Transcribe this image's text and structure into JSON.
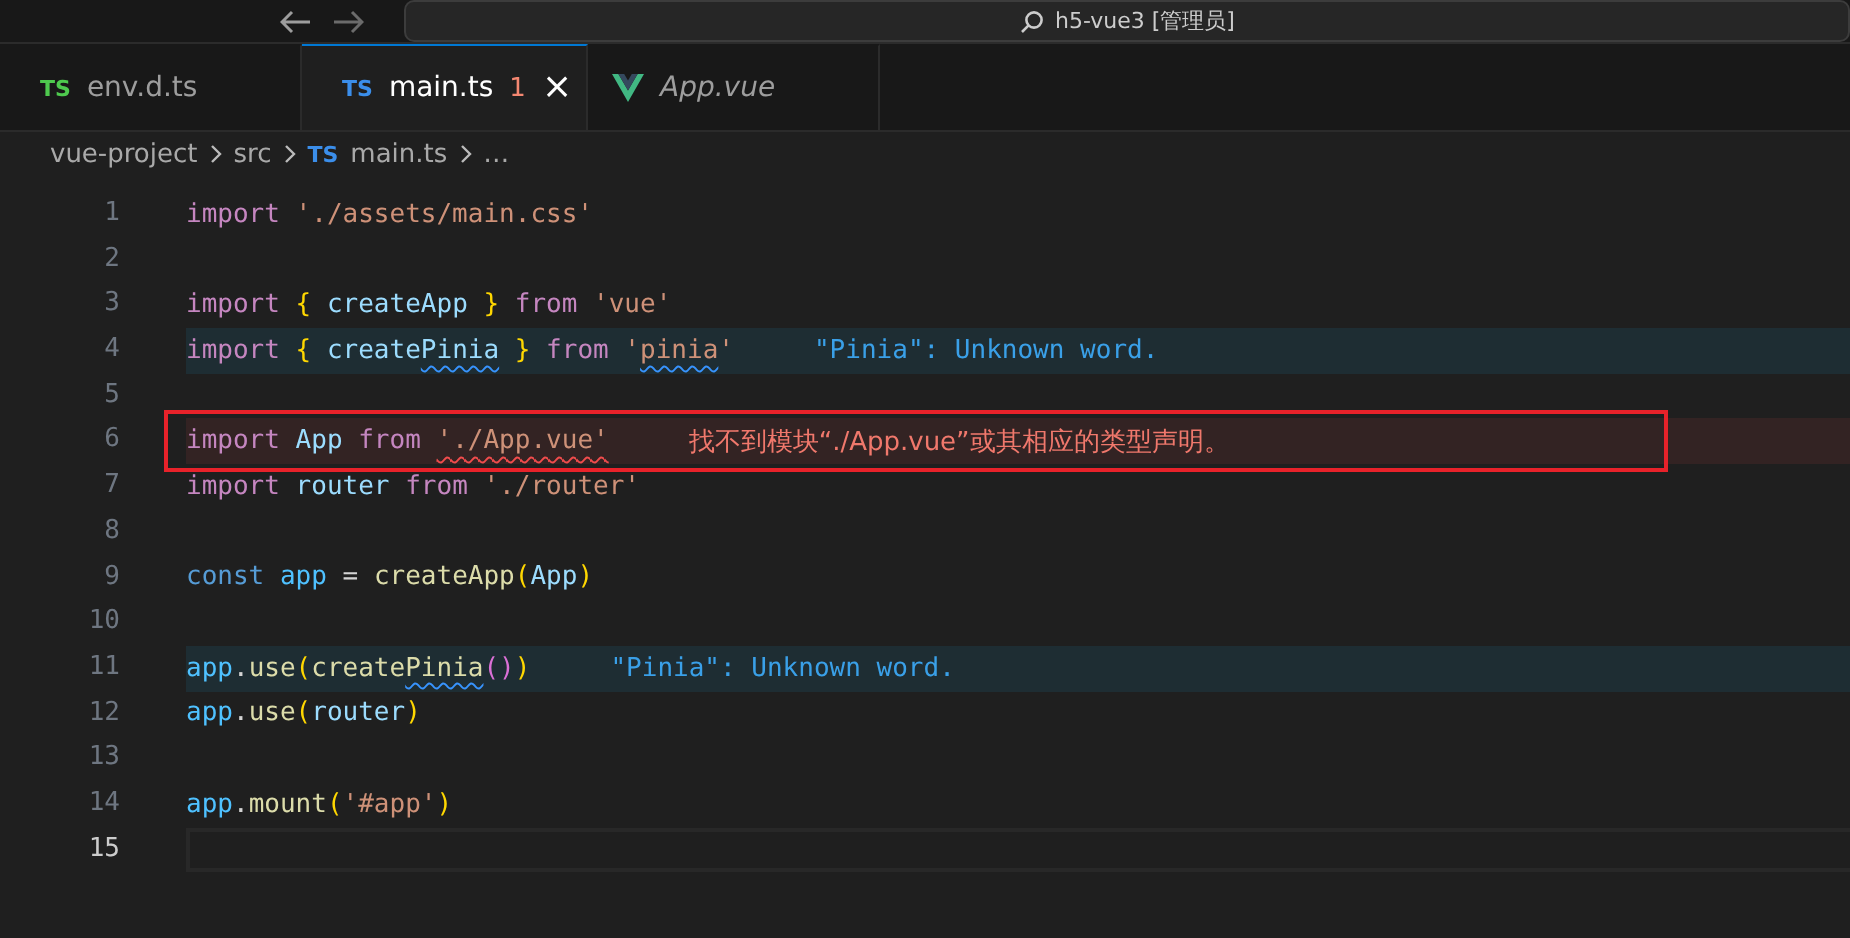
{
  "title_bar": {
    "title": "h5-vue3 [管理员]"
  },
  "tabs": [
    {
      "kind": "ts",
      "icon_text": "TS",
      "color": "#4ec94e",
      "label": "env.d.ts",
      "selected": false,
      "error": false,
      "preview": false
    },
    {
      "kind": "ts",
      "icon_text": "TS",
      "color": "#3b8eea",
      "label": "main.ts",
      "selected": true,
      "error": true,
      "problems": "1",
      "close": "×",
      "preview": false
    },
    {
      "kind": "vue",
      "label": "App.vue",
      "selected": false,
      "error": false,
      "preview": true
    }
  ],
  "breadcrumb": [
    {
      "kind": "text",
      "label": "vue-project"
    },
    {
      "kind": "text",
      "label": "src"
    },
    {
      "kind": "file",
      "icon_text": "TS",
      "label": "main.ts"
    },
    {
      "kind": "text",
      "label": "…"
    }
  ],
  "lines": [
    {
      "number": "1",
      "tokens": [
        {
          "t": "import",
          "kind": "keyword"
        },
        {
          "t": " './assets/main.css'",
          "kind": "string"
        }
      ]
    },
    {
      "number": "2"
    },
    {
      "number": "3",
      "tokens": [
        {
          "t": "import",
          "kind": "keyword"
        },
        {
          "t": " {",
          "kind": "bracket"
        },
        {
          "t": " createApp",
          "kind": "variable"
        },
        {
          "t": " }",
          "kind": "bracket"
        },
        {
          "t": " from",
          "kind": "keyword"
        },
        {
          "t": " 'vue'",
          "kind": "string"
        }
      ]
    },
    {
      "number": "4",
      "kind": "info",
      "message": "\"Pinia\": Unknown word.",
      "tokens": [
        {
          "t": "import",
          "kind": "keyword"
        },
        {
          "t": " {",
          "kind": "bracket"
        },
        {
          "t": " create",
          "kind": "variable"
        },
        {
          "t": "Pinia",
          "kind": "variable",
          "underlined": true
        },
        {
          "t": " }",
          "kind": "bracket"
        },
        {
          "t": " from",
          "kind": "keyword"
        },
        {
          "t": " '",
          "kind": "string"
        },
        {
          "t": "pinia",
          "kind": "string",
          "underlined": true
        },
        {
          "t": "'",
          "kind": "string"
        }
      ]
    },
    {
      "number": "5"
    },
    {
      "number": "6",
      "kind": "error",
      "annotated": true,
      "message": "找不到模块“./App.vue”或其相应的类型声明。",
      "tokens": [
        {
          "t": "import",
          "kind": "keyword"
        },
        {
          "t": " App",
          "kind": "variable"
        },
        {
          "t": " from ",
          "kind": "keyword"
        },
        {
          "t": "'./App.vue'",
          "kind": "string",
          "underlined": true
        }
      ]
    },
    {
      "number": "7",
      "tokens": [
        {
          "t": "import",
          "kind": "keyword"
        },
        {
          "t": " router",
          "kind": "variable"
        },
        {
          "t": " from",
          "kind": "keyword"
        },
        {
          "t": " './router'",
          "kind": "string"
        }
      ]
    },
    {
      "number": "8"
    },
    {
      "number": "9",
      "tokens": [
        {
          "t": "const",
          "kind": "declaration"
        },
        {
          "t": " app",
          "kind": "constant"
        },
        {
          "t": " = ",
          "kind": "operator"
        },
        {
          "t": "createApp",
          "kind": "function"
        },
        {
          "t": "(",
          "kind": "bracket"
        },
        {
          "t": "App",
          "kind": "variable"
        },
        {
          "t": ")",
          "kind": "bracket"
        }
      ]
    },
    {
      "number": "10"
    },
    {
      "number": "11",
      "kind": "info",
      "message": "\"Pinia\": Unknown word.",
      "tokens": [
        {
          "t": "app",
          "kind": "constant"
        },
        {
          "t": ".",
          "kind": "operator"
        },
        {
          "t": "use",
          "kind": "function"
        },
        {
          "t": "(",
          "kind": "bracket"
        },
        {
          "t": "create",
          "kind": "function"
        },
        {
          "t": "Pinia",
          "kind": "function",
          "underlined": true
        },
        {
          "t": "()",
          "kind": "inner-bracket"
        },
        {
          "t": ")",
          "kind": "bracket"
        }
      ]
    },
    {
      "number": "12",
      "tokens": [
        {
          "t": "app",
          "kind": "constant"
        },
        {
          "t": ".",
          "kind": "operator"
        },
        {
          "t": "use",
          "kind": "function"
        },
        {
          "t": "(",
          "kind": "bracket"
        },
        {
          "t": "router",
          "kind": "variable"
        },
        {
          "t": ")",
          "kind": "bracket"
        }
      ]
    },
    {
      "number": "13"
    },
    {
      "number": "14",
      "tokens": [
        {
          "t": "app",
          "kind": "constant"
        },
        {
          "t": ".",
          "kind": "operator"
        },
        {
          "t": "mount",
          "kind": "function"
        },
        {
          "t": "(",
          "kind": "bracket"
        },
        {
          "t": "'#app'",
          "kind": "string"
        },
        {
          "t": ")",
          "kind": "bracket"
        }
      ]
    },
    {
      "number": "15",
      "current": true
    }
  ]
}
